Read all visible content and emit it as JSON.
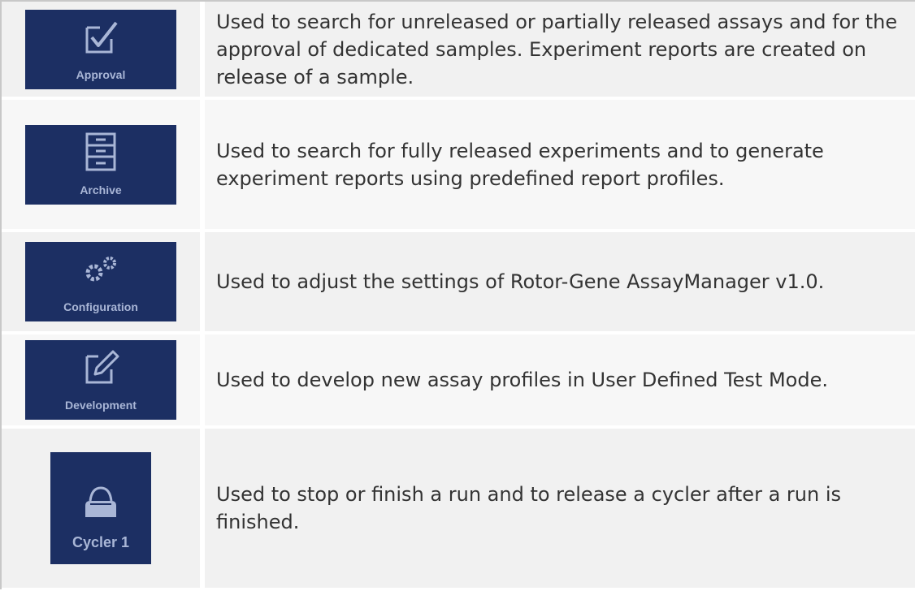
{
  "rows": [
    {
      "tile_label": "Approval",
      "icon": "approval-checkbox-icon",
      "description": "Used to search for unreleased or partially released assays and for the approval of dedicated samples. Experiment reports are created on release of a sample."
    },
    {
      "tile_label": "Archive",
      "icon": "archive-cabinet-icon",
      "description": "Used to search for fully released experiments and to generate experiment reports using predefined report profiles."
    },
    {
      "tile_label": "Configuration",
      "icon": "gears-icon",
      "description": "Used to adjust the settings of Rotor-Gene AssayManager v1.0."
    },
    {
      "tile_label": "Development",
      "icon": "pencil-edit-icon",
      "description": "Used to develop new assay profiles in User Defined Test Mode."
    },
    {
      "tile_label": "Cycler 1",
      "icon": "cycler-icon",
      "description": "Used to stop or finish a run and to release a cycler after a run is finished."
    }
  ],
  "colors": {
    "tile_bg": "#1c2f63",
    "tile_text": "#a9b6d6",
    "cell_bg": "#f1f1f1",
    "body_text": "#333333"
  }
}
